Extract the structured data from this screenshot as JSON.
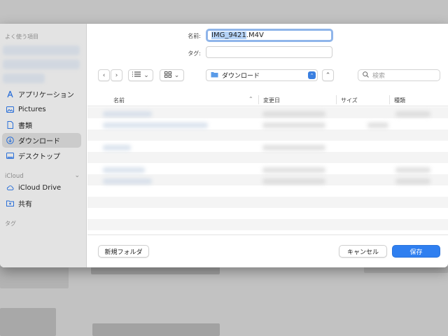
{
  "dialog": {
    "name_label": "名前:",
    "name_value_selected": "IMG_9421",
    "name_value_ext": ".M4V",
    "tag_label": "タグ:",
    "location": "ダウンロード",
    "search_placeholder": "検索"
  },
  "sidebar": {
    "favorites_header": "よく使う項目",
    "items": [
      {
        "label": "アプリケーション",
        "icon": "applications-icon"
      },
      {
        "label": "Pictures",
        "icon": "pictures-icon"
      },
      {
        "label": "書類",
        "icon": "document-icon"
      },
      {
        "label": "ダウンロード",
        "icon": "downloads-icon"
      },
      {
        "label": "デスクトップ",
        "icon": "desktop-icon"
      }
    ],
    "icloud_header": "iCloud",
    "icloud_items": [
      {
        "label": "iCloud Drive",
        "icon": "icloud-icon"
      },
      {
        "label": "共有",
        "icon": "shared-folder-icon"
      }
    ],
    "tags_header": "タグ"
  },
  "columns": {
    "name": "名前",
    "modified": "変更日",
    "size": "サイズ",
    "kind": "種類"
  },
  "buttons": {
    "new_folder": "新規フォルダ",
    "cancel": "キャンセル",
    "save": "保存"
  },
  "colors": {
    "accent": "#2f7ff0",
    "sidebar_bg": "#e3e3e3",
    "selection": "#b4d2f6"
  }
}
